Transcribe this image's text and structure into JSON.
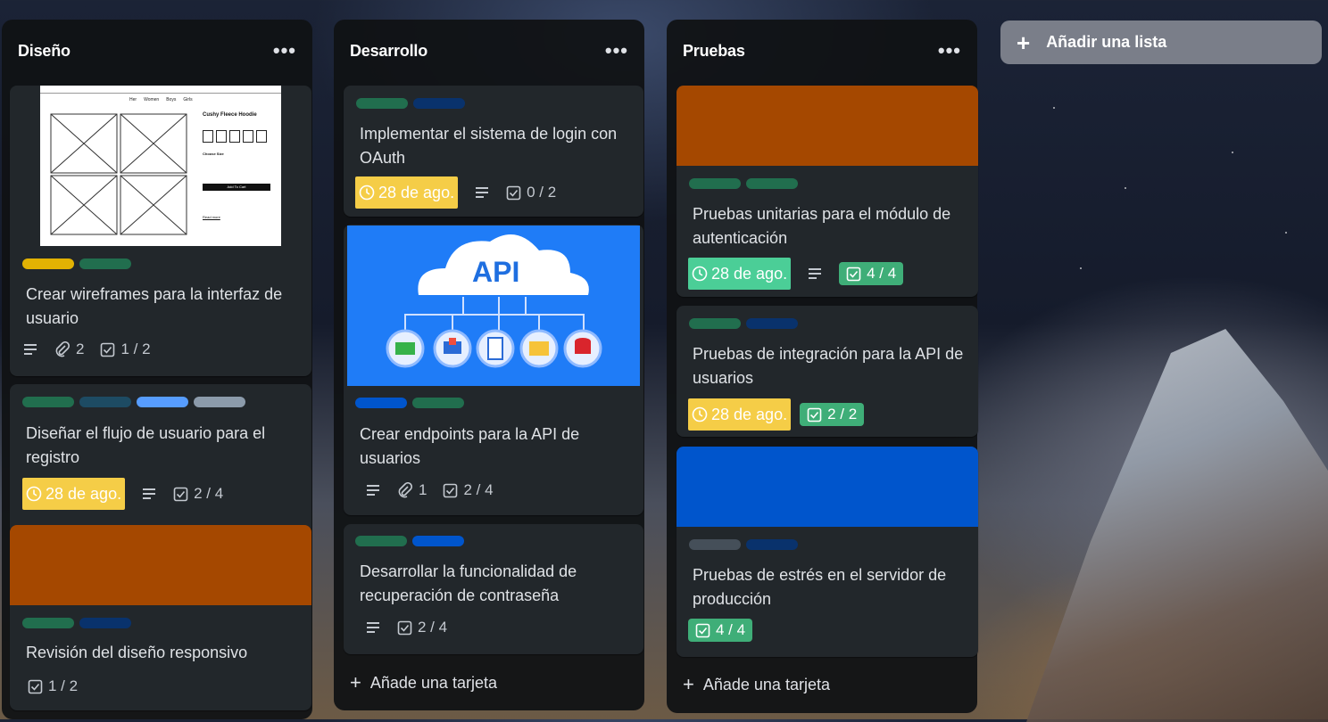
{
  "board": {
    "lists": [
      {
        "title": "Diseño",
        "cards": [
          {
            "title": "Crear wireframes para la interfaz de usuario",
            "attachments": "2",
            "checklist": "1 / 2",
            "wireframe": {
              "product": "Cushy Fleece Hoodie",
              "nav": [
                "Her",
                "Women",
                "Boys",
                "Girls"
              ],
              "button": "Add To Cart",
              "size_label": "Choose Size",
              "link": "Read more"
            }
          },
          {
            "title": "Diseñar el flujo de usuario para el registro",
            "due": "28 de ago.",
            "checklist": "2 / 4"
          },
          {
            "title": "Revisión del diseño responsivo",
            "checklist": "1 / 2"
          }
        ]
      },
      {
        "title": "Desarrollo",
        "cards": [
          {
            "title": "Implementar el sistema de login con OAuth",
            "due": "28 de ago.",
            "checklist": "0 / 2"
          },
          {
            "title": "Crear endpoints para la API de usuarios",
            "attachments": "1",
            "checklist": "2 / 4",
            "cover_text": "API"
          },
          {
            "title": "Desarrollar la funcionalidad de recuperación de contraseña",
            "checklist": "2 / 4"
          }
        ],
        "add_card": "Añade una tarjeta"
      },
      {
        "title": "Pruebas",
        "cards": [
          {
            "title": "Pruebas unitarias para el módulo de autenticación",
            "due": "28 de ago.",
            "checklist": "4 / 4"
          },
          {
            "title": "Pruebas de integración para la API de usuarios",
            "due": "28 de ago.",
            "checklist": "2 / 2"
          },
          {
            "title": "Pruebas de estrés en el servidor de producción",
            "checklist": "4 / 4"
          }
        ],
        "add_card": "Añade una tarjeta"
      }
    ],
    "add_list": "Añadir una lista",
    "menu_glyph": "•••",
    "icons": [
      "description-icon",
      "attachment-icon",
      "checklist-icon",
      "clock-icon",
      "plus-icon",
      "menu-icon"
    ]
  },
  "colors": {
    "label_green": "#216e4e",
    "label_blue": "#0055cc",
    "label_yellow": "#e2b203",
    "label_teal": "#1d4b63",
    "label_light_blue": "#579dff",
    "label_gray": "#8c9bab",
    "label_dark_gray": "#454f59",
    "due_yellow": "#f5cd47",
    "due_green": "#4bce97",
    "cover_orange": "#a54800",
    "cover_blue": "#0055cc"
  }
}
